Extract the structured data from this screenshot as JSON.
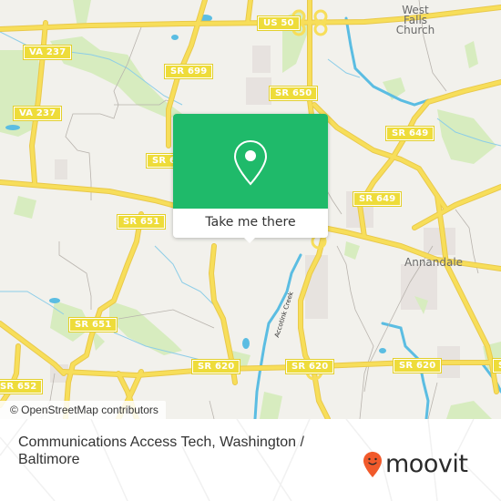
{
  "map": {
    "colors": {
      "background": "#f2f1ec",
      "park": "#d7ecbf",
      "water": "#5bbde2",
      "road": "#f7de5a",
      "road_casing": "#e9c94a",
      "residential": "#e6e1de",
      "minor_road": "#b8b3ad"
    },
    "road_shields": [
      {
        "id": "us50",
        "label": "US 50"
      },
      {
        "id": "va237a",
        "label": "VA 237"
      },
      {
        "id": "va237b",
        "label": "VA 237"
      },
      {
        "id": "sr699",
        "label": "SR 699"
      },
      {
        "id": "sr650",
        "label": "SR 650"
      },
      {
        "id": "sr649a",
        "label": "SR 649"
      },
      {
        "id": "sr649b",
        "label": "SR 649"
      },
      {
        "id": "sr6xx",
        "label": "SR 6"
      },
      {
        "id": "sr651a",
        "label": "SR 651"
      },
      {
        "id": "sr651b",
        "label": "SR 651"
      },
      {
        "id": "sr652",
        "label": "SR 652"
      },
      {
        "id": "sr620a",
        "label": "SR 620"
      },
      {
        "id": "sr620b",
        "label": "SR 620"
      },
      {
        "id": "sr620c",
        "label": "SR 620"
      },
      {
        "id": "sr620d",
        "label": "SR 620"
      },
      {
        "id": "sr620e",
        "label": "SR"
      }
    ],
    "places": {
      "west_falls_church": [
        "West",
        "Falls",
        "Church"
      ],
      "annandale": "Annandale"
    },
    "waterway_label": "Accotink Creek",
    "attribution": "© OpenStreetMap contributors"
  },
  "popup": {
    "accent": "#1fba6a",
    "icon": "location-pin-icon",
    "button_label": "Take me there"
  },
  "footer": {
    "title": "Communications Access Tech, Washington / Baltimore",
    "brand": "moovit",
    "brand_color": "#f15a2b"
  }
}
